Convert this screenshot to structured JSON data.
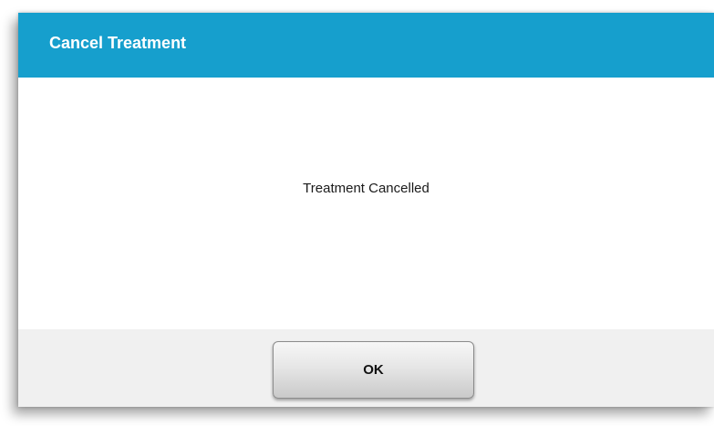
{
  "dialog": {
    "title": "Cancel Treatment",
    "message": "Treatment Cancelled",
    "ok_label": "OK"
  },
  "colors": {
    "header": "#169fcd",
    "footer": "#f0f0f0",
    "body": "#ffffff"
  }
}
